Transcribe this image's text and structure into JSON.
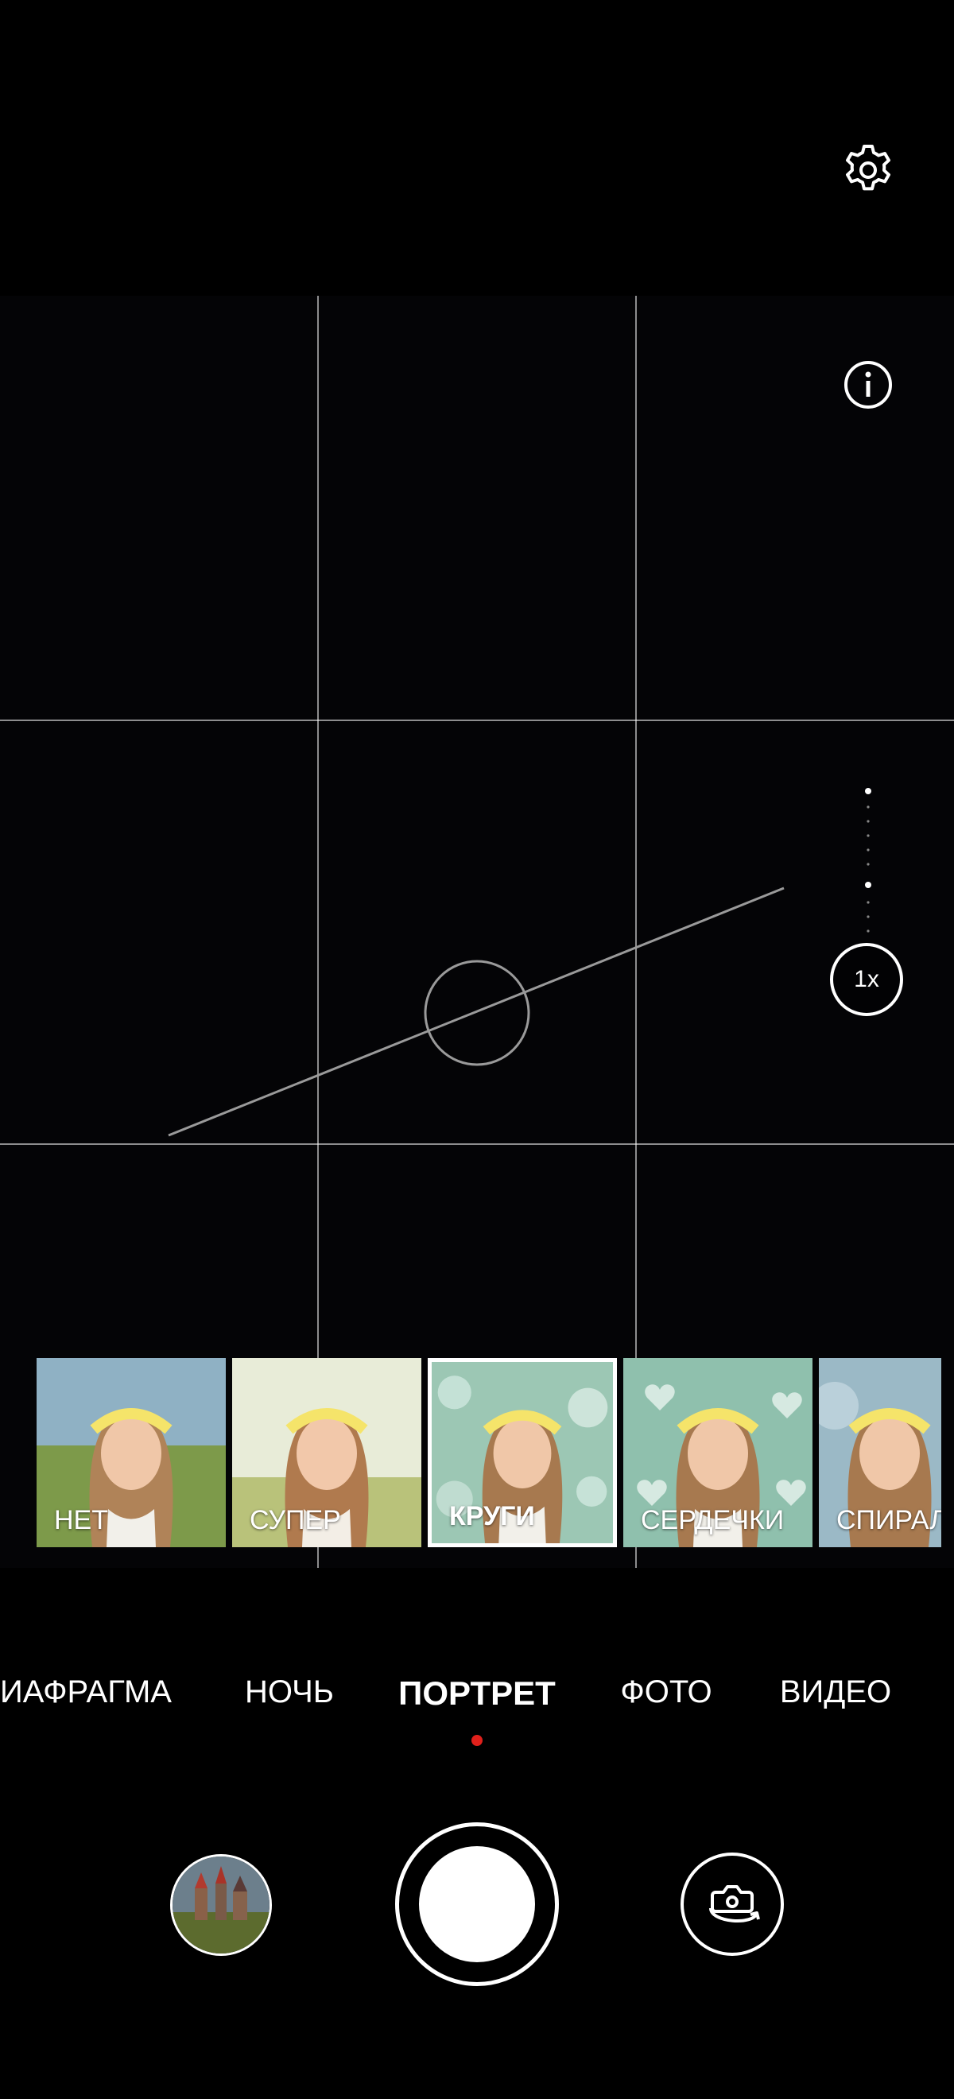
{
  "camera": {
    "zoom_label": "1x",
    "icons": {
      "settings": "gear-icon",
      "info": "info-icon",
      "switch_camera": "switch-camera-icon",
      "shutter": "shutter-button"
    },
    "effects": [
      {
        "label": "НЕТ",
        "selected": false
      },
      {
        "label": "СУПЕР",
        "selected": false
      },
      {
        "label": "КРУГИ",
        "selected": true
      },
      {
        "label": "СЕРДЕЧКИ",
        "selected": false
      },
      {
        "label": "СПИРАЛ",
        "selected": false
      }
    ],
    "modes": [
      {
        "label": "ИАФРАГМА",
        "active": false
      },
      {
        "label": "НОЧЬ",
        "active": false
      },
      {
        "label": "ПОРТРЕТ",
        "active": true
      },
      {
        "label": "ФОТО",
        "active": false
      },
      {
        "label": "ВИДЕО",
        "active": false
      }
    ],
    "colors": {
      "background": "#000000",
      "accent_dot": "#e0201b"
    }
  }
}
